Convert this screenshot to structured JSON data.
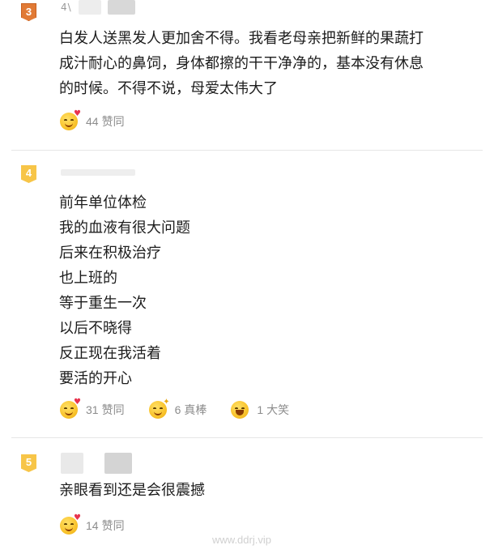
{
  "comments": [
    {
      "rank": "3",
      "username": "4\\",
      "text_lines": [
        "白发人送黑发人更加舍不得。我看老母亲把新鲜的果蔬打",
        "成汁耐心的鼻饲，身体都擦的干干净净的，基本没有休息",
        "的时候。不得不说，母爱太伟大了"
      ],
      "reactions": [
        {
          "icon": "heart-eyes-emoji-icon",
          "count": "44",
          "label": "赞同"
        }
      ]
    },
    {
      "rank": "4",
      "username": "",
      "text_lines": [
        "前年单位体检",
        "我的血液有很大问题",
        "后来在积极治疗",
        "也上班的",
        "等于重生一次",
        "以后不晓得",
        "反正现在我活着",
        "要活的开心"
      ],
      "reactions": [
        {
          "icon": "heart-eyes-emoji-icon",
          "count": "31",
          "label": "赞同"
        },
        {
          "icon": "thumbs-up-emoji-icon",
          "count": "6",
          "label": "真棒"
        },
        {
          "icon": "laughing-emoji-icon",
          "count": "1",
          "label": "大笑"
        }
      ]
    },
    {
      "rank": "5",
      "username": "",
      "text_lines": [
        "亲眼看到还是会很震撼"
      ],
      "reactions": [
        {
          "icon": "heart-eyes-emoji-icon",
          "count": "14",
          "label": "赞同"
        }
      ]
    }
  ],
  "watermark": "www.ddrj.vip",
  "colors": {
    "badge_dark": "#e17a35",
    "badge_light": "#f7c548",
    "text": "#1c1c1c",
    "meta": "#8c8c8c",
    "divider": "#e6e6e6"
  }
}
